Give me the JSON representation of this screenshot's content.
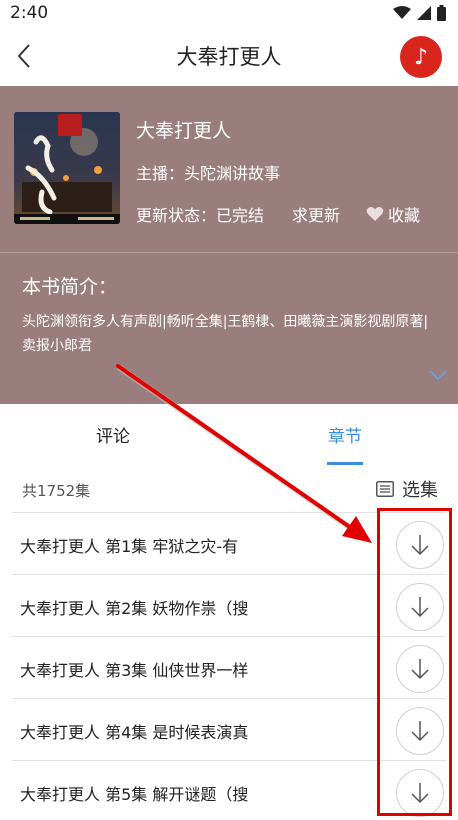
{
  "status": {
    "time": "2:40"
  },
  "header": {
    "title": "大奉打更人",
    "music_icon": "♪"
  },
  "book": {
    "title": "大奉打更人",
    "anchor": "主播：头陀渊讲故事",
    "update_status": "更新状态：已完结",
    "request_update": "求更新",
    "favorite": "收藏"
  },
  "intro": {
    "heading": "本书简介：",
    "text": "头陀渊领衔多人有声剧|畅听全集|王鹤棣、田曦薇主演影视剧原著|卖报小郎君"
  },
  "tabs": [
    {
      "label": "评论"
    },
    {
      "label": "章节"
    }
  ],
  "list": {
    "count": "共1752集",
    "select_label": "选集"
  },
  "episodes": [
    {
      "title": "大奉打更人 第1集 牢狱之灾-有"
    },
    {
      "title": "大奉打更人 第2集 妖物作祟（搜"
    },
    {
      "title": "大奉打更人 第3集 仙侠世界一样"
    },
    {
      "title": "大奉打更人 第4集 是时候表演真"
    },
    {
      "title": "大奉打更人 第5集 解开谜题（搜"
    }
  ],
  "colors": {
    "accent": "#3b8fd8",
    "brand_red": "#d9261c",
    "panel": "#9a7e7e",
    "annotation": "#e00000"
  }
}
